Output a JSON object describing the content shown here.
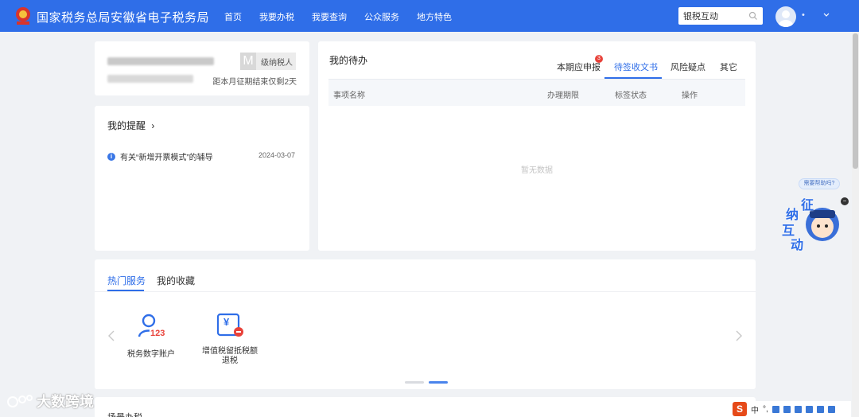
{
  "header": {
    "site_title": "国家税务总局安徽省电子税务局",
    "nav": [
      "首页",
      "我要办税",
      "我要查询",
      "公众服务",
      "地方特色"
    ],
    "search_value": "银税互动",
    "user_masked": "•",
    "colors": {
      "brand": "#2f6ee8"
    }
  },
  "profile": {
    "taxpayer_level_letter": "M",
    "taxpayer_level_label": "级纳税人",
    "deadline_prefix": "距本月征期结束仅剩",
    "deadline_days": "2",
    "deadline_suffix": "天"
  },
  "reminders": {
    "title": "我的提醒",
    "items": [
      {
        "text": "有关“新增开票模式”的辅导",
        "date": "2024-03-07"
      }
    ]
  },
  "todo": {
    "title": "我的待办",
    "tabs": [
      {
        "label": "本期应申报",
        "badge": "3"
      },
      {
        "label": "待签收文书",
        "active": true
      },
      {
        "label": "风险疑点"
      },
      {
        "label": "其它"
      }
    ],
    "columns": [
      "事项名称",
      "办理期限",
      "标签状态",
      "操作"
    ],
    "empty_text": "暂无数据"
  },
  "services": {
    "tabs": [
      "热门服务",
      "我的收藏"
    ],
    "items": [
      {
        "label": "税务数字账户",
        "icon": "user-account-icon",
        "icon_text": "123"
      },
      {
        "label": "增值税留抵税额退税",
        "icon": "tax-refund-icon",
        "icon_text": "¥"
      }
    ],
    "page_count": 2,
    "active_page": 2
  },
  "bottom_section": {
    "label": "场景办税"
  },
  "helper": {
    "bubble": "需要帮助吗?",
    "chars": [
      "征",
      "纳",
      "互",
      "动"
    ]
  },
  "watermark": "大数跨境",
  "ime_bar": {
    "logo": "S",
    "mode": "中",
    "punct": "°,"
  }
}
